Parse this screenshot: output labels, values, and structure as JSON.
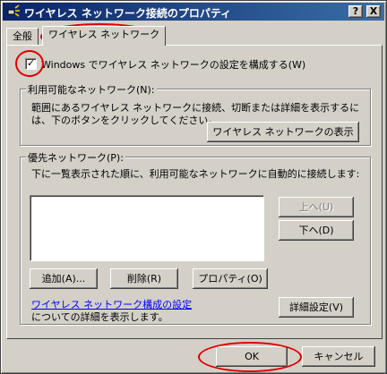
{
  "window": {
    "title": "ワイヤレス ネットワーク接続のプロパティ",
    "help_btn": "?",
    "close_btn": "X"
  },
  "tabs": [
    {
      "label": "全般"
    },
    {
      "label": "ワイヤレス ネットワーク"
    }
  ],
  "config": {
    "checkbox_checked": true,
    "checkbox_label": "Windows でワイヤレス ネットワークの設定を構成する(W)"
  },
  "available": {
    "legend": "利用可能なネットワーク(N):",
    "description_line1": "範囲にあるワイヤレス ネットワークに接続、切断または詳細を表示するに",
    "description_line2": "は、下のボタンをクリックしてください。",
    "show_button": "ワイヤレス ネットワークの表示"
  },
  "preferred": {
    "legend": "優先ネットワーク(P):",
    "description": "下に一覧表示された順に、利用可能なネットワークに自動的に接続します:",
    "up_button": "上へ(U)",
    "down_button": "下へ(D)",
    "add_button": "追加(A)...",
    "remove_button": "削除(R)",
    "properties_button": "プロパティ(O)"
  },
  "footer": {
    "link_text": "ワイヤレス ネットワーク構成の設定",
    "link_suffix": "についての詳細を表示します。",
    "advanced_button": "詳細設定(V)"
  },
  "dialog": {
    "ok_button": "OK",
    "cancel_button": "キャンセル"
  },
  "colors": {
    "annotation": "#e00000",
    "titlebar_start": "#0a246a",
    "titlebar_end": "#3a6ea5"
  }
}
